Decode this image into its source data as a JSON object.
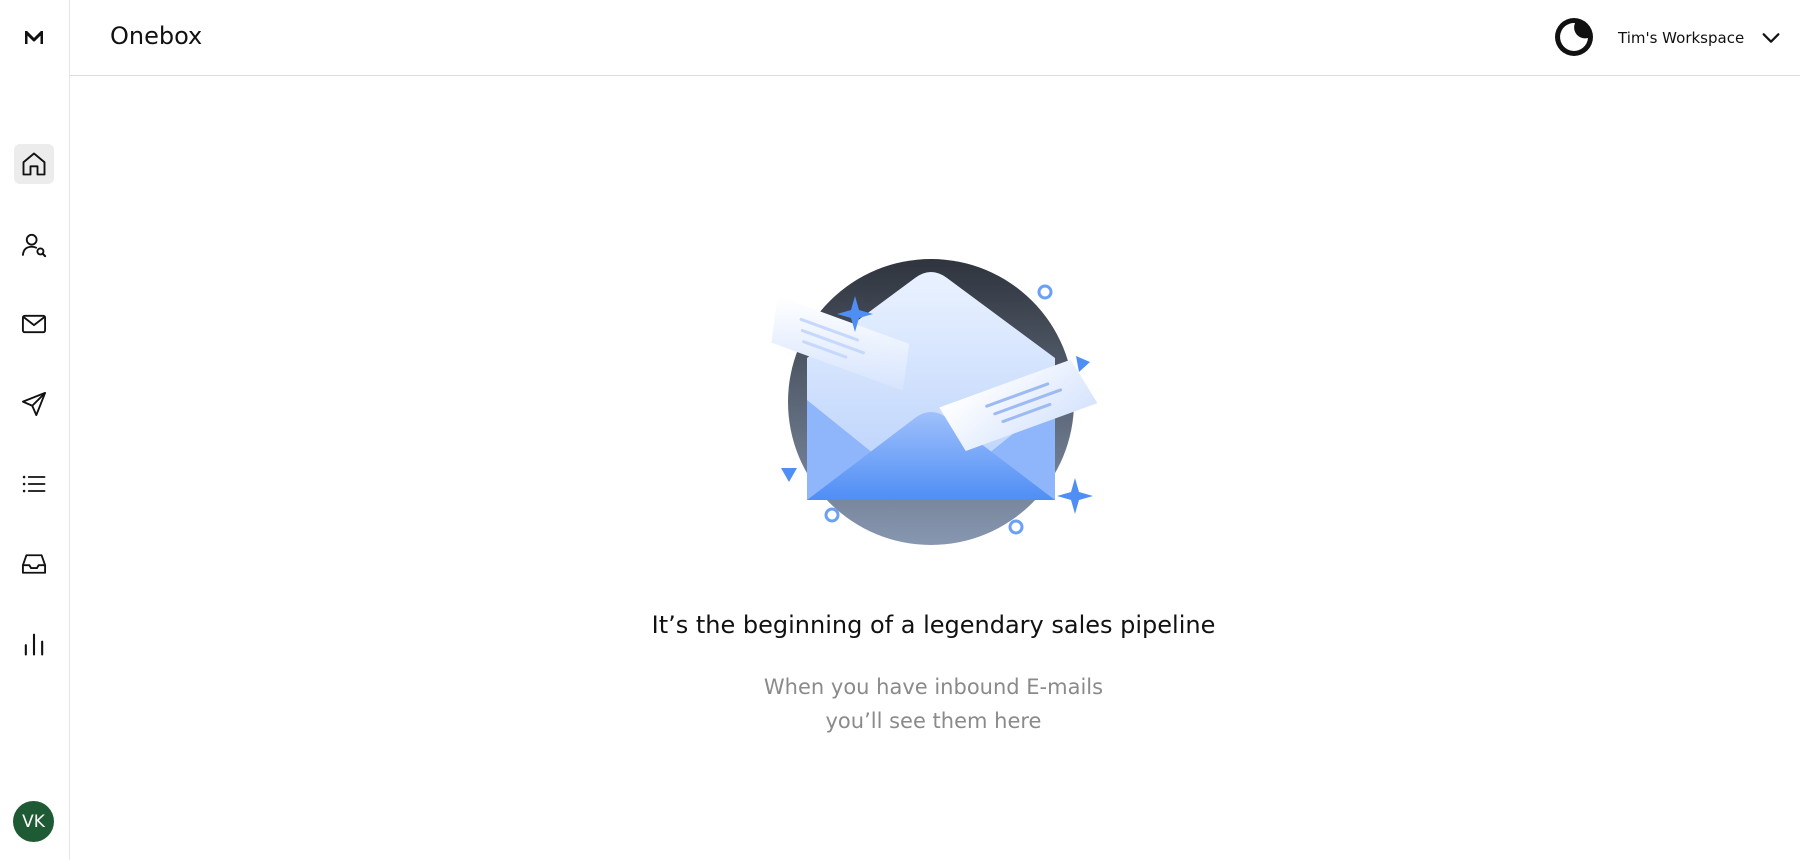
{
  "app": {
    "logo_letter": "M",
    "page_title": "Onebox"
  },
  "header": {
    "theme_toggle_icon": "moon-icon",
    "workspace_name": "Tim's Workspace",
    "workspace_dropdown_icon": "chevron-down-icon"
  },
  "sidebar": {
    "items": [
      {
        "icon": "home-icon",
        "active": true
      },
      {
        "icon": "user-search-icon",
        "active": false
      },
      {
        "icon": "mail-icon",
        "active": false
      },
      {
        "icon": "send-icon",
        "active": false
      },
      {
        "icon": "list-icon",
        "active": false
      },
      {
        "icon": "inbox-icon",
        "active": false
      },
      {
        "icon": "bar-chart-icon",
        "active": false
      }
    ],
    "avatar": {
      "initials": "VK",
      "color": "#1e5b34"
    }
  },
  "empty_state": {
    "illustration": "envelope-illustration",
    "title": "It’s the beginning of a legendary sales pipeline",
    "subtitle_line1": "When you have inbound E-mails",
    "subtitle_line2": "you’ll see them here"
  },
  "colors": {
    "accent_blue": "#5b95f6",
    "dark_circle": "#353b46"
  }
}
